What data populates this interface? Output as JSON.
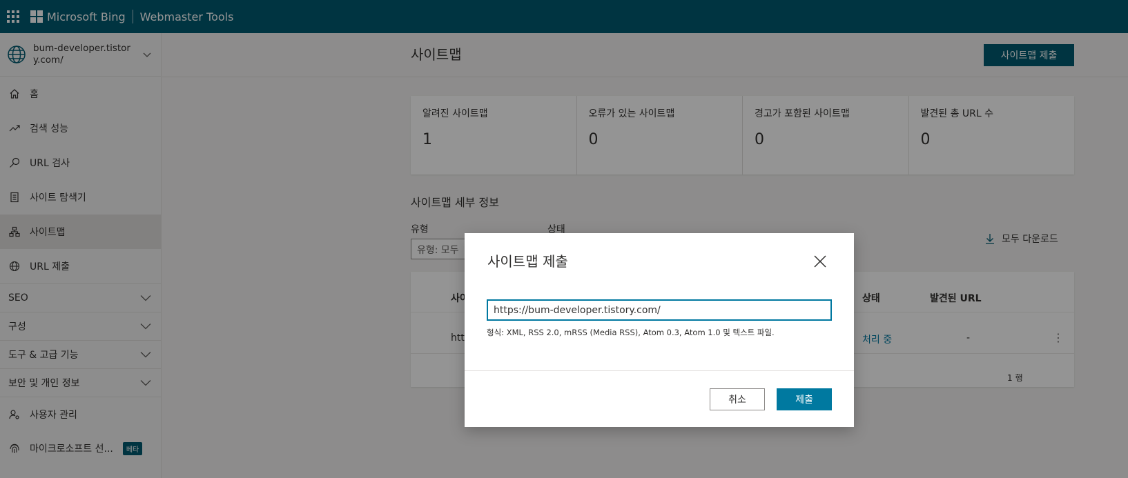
{
  "topbar": {
    "brand": "Microsoft Bing",
    "product": "Webmaster Tools"
  },
  "sidebar": {
    "site": "bum-developer.tistory.com/",
    "items": [
      {
        "label": "홈",
        "icon": "home-icon"
      },
      {
        "label": "검색 성능",
        "icon": "trend-icon"
      },
      {
        "label": "URL 검사",
        "icon": "search-icon"
      },
      {
        "label": "사이트 탐색기",
        "icon": "document-icon"
      },
      {
        "label": "사이트맵",
        "icon": "sitemap-icon",
        "active": true
      },
      {
        "label": "URL 제출",
        "icon": "globe-icon"
      }
    ],
    "groups": [
      "SEO",
      "구성",
      "도구 & 고급 기능",
      "보안 및 개인 정보"
    ],
    "bottom": [
      {
        "label": "사용자 관리",
        "icon": "user-settings-icon"
      },
      {
        "label": "마이크로소프트 선...",
        "icon": "fingerprint-icon",
        "badge": "베타"
      }
    ]
  },
  "main": {
    "title": "사이트맵",
    "submit_button": "사이트맵 제출",
    "stats": [
      {
        "label": "알려진 사이트맵",
        "value": "1"
      },
      {
        "label": "오류가 있는 사이트맵",
        "value": "0"
      },
      {
        "label": "경고가 포함된 사이트맵",
        "value": "0"
      },
      {
        "label": "발견된 총 URL 수",
        "value": "0"
      }
    ],
    "details_title": "사이트맵 세부 정보",
    "filter_type_label": "유형",
    "filter_status_label": "상태",
    "filter_type_value": "유형: 모두",
    "download_all": "모두 다운로드",
    "table": {
      "col_sitemap": "사이",
      "col_status": "상태",
      "col_urls": "발견된 URL",
      "row": {
        "url": "htt",
        "status": "처리 중",
        "urls": "-"
      },
      "row_count": "1 행"
    }
  },
  "dialog": {
    "title": "사이트맵 제출",
    "input_value": "https://bum-developer.tistory.com/",
    "hint": "형식: XML, RSS 2.0, mRSS (Media RSS), Atom 0.3, Atom 1.0 및 텍스트 파일.",
    "cancel": "취소",
    "submit": "제출"
  },
  "colors": {
    "header_teal": "#005b70",
    "primary_button": "#0079a0",
    "link": "#0078a0"
  }
}
